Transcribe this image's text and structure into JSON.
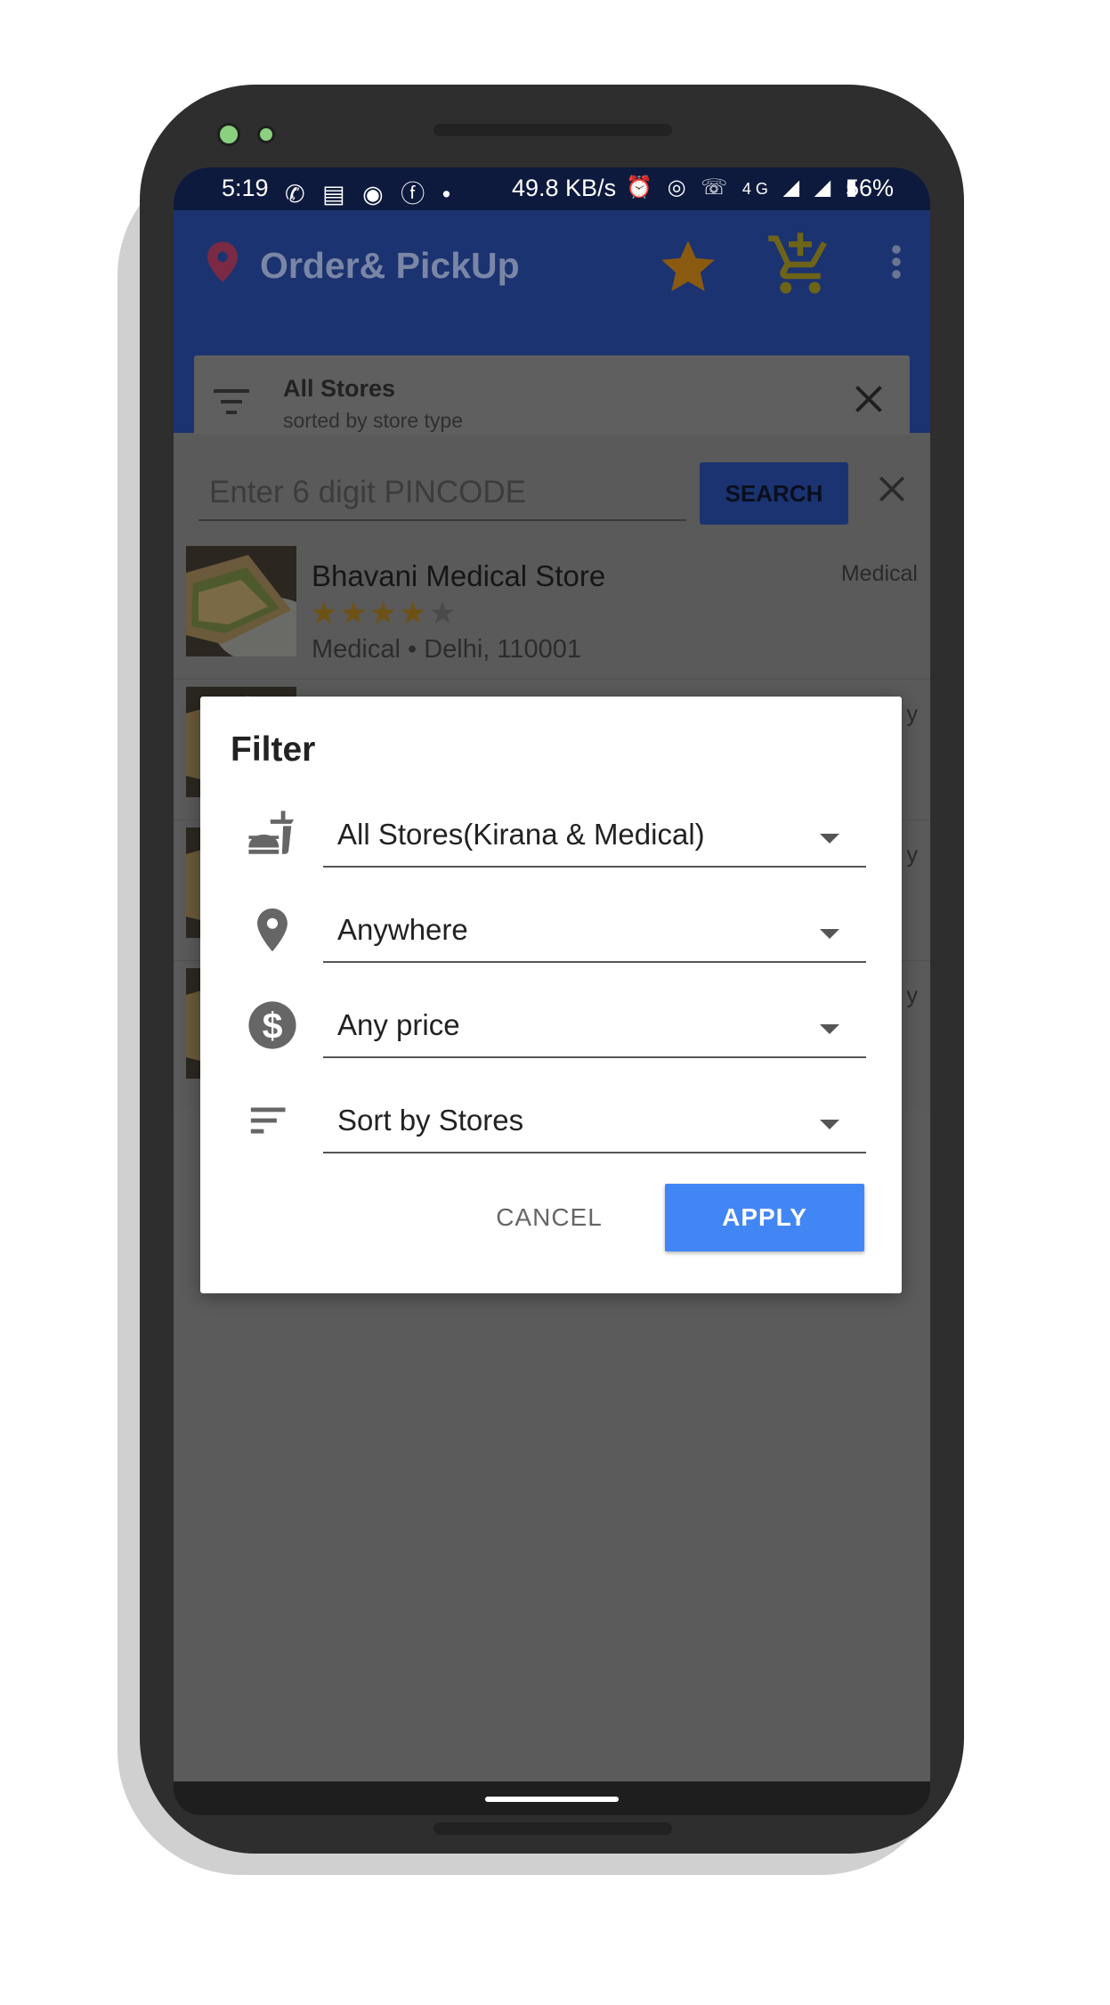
{
  "status_bar": {
    "time": "5:19",
    "notification_icons": [
      "whatsapp-icon",
      "news-icon",
      "pinterest-icon",
      "facebook-icon",
      "dot-icon"
    ],
    "network_speed": "49.8 KB/s",
    "system_icons": [
      "alarm-icon",
      "hotspot-icon",
      "volte-icon",
      "4g-icon",
      "signal-1-icon",
      "signal-2r-icon"
    ],
    "battery": "56%"
  },
  "app_bar": {
    "title": "Order& PickUp",
    "colors": {
      "background": "#1b3370",
      "star": "#8a5a10",
      "cart": "#6e6418"
    }
  },
  "filter_chip": {
    "title": "All Stores",
    "subtitle": "sorted by store type"
  },
  "search": {
    "placeholder": "Enter 6 digit PINCODE",
    "button_label": "SEARCH"
  },
  "stores": [
    {
      "name": "Bhavani Medical Store",
      "type": "Medical",
      "rating": 4.5,
      "stars_full": "★★★★",
      "stars_half": "★",
      "meta": "Medical • Delhi, 110001"
    },
    {
      "name": "",
      "type": "y",
      "rating": null,
      "stars_full": "",
      "stars_half": "",
      "meta": ""
    },
    {
      "name": "",
      "type": "y",
      "rating": null,
      "stars_full": "",
      "stars_half": "",
      "meta": ""
    },
    {
      "name": "",
      "type": "y",
      "rating": null,
      "stars_full": "",
      "stars_half": "",
      "meta": ""
    }
  ],
  "dialog": {
    "title": "Filter",
    "fields": [
      {
        "icon": "restaurant-icon",
        "value": "All Stores(Kirana & Medical)"
      },
      {
        "icon": "location-pin-icon",
        "value": "Anywhere"
      },
      {
        "icon": "dollar-icon",
        "value": "Any price"
      },
      {
        "icon": "sort-icon",
        "value": "Sort by Stores"
      }
    ],
    "cancel_label": "CANCEL",
    "apply_label": "APPLY",
    "colors": {
      "apply": "#4286f5"
    }
  }
}
